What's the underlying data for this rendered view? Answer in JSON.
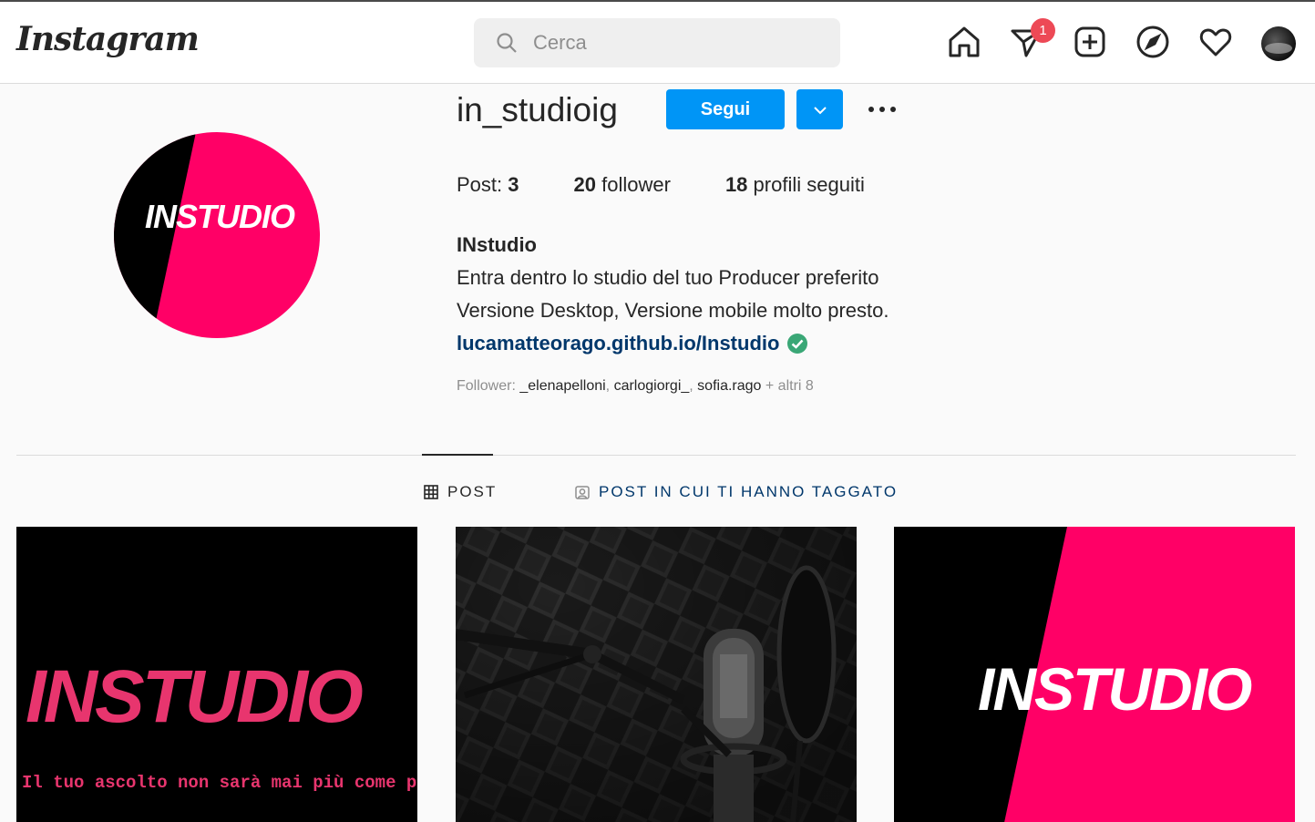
{
  "header": {
    "logo": "Instagram",
    "search_placeholder": "Cerca",
    "notification_count": "1",
    "icons": [
      "home-icon",
      "direct-message-icon",
      "new-post-icon",
      "explore-icon",
      "activity-heart-icon",
      "profile-avatar"
    ]
  },
  "profile": {
    "username": "in_studioig",
    "follow_label": "Segui",
    "picture_text": "INSTUDIO",
    "stats": {
      "posts_label": "Post:",
      "posts_count": "3",
      "followers_count": "20",
      "followers_label": "follower",
      "following_count": "18",
      "following_label": "profili seguiti"
    },
    "full_name": "INstudio",
    "bio_line1": "Entra dentro lo studio del tuo Producer preferito",
    "bio_line2": "Versione Desktop, Versione mobile molto presto.",
    "link": "lucamatteorago.github.io/Instudio",
    "followed_by": {
      "prefix": "Follower:",
      "user1": "_elenapelloni",
      "user2": "carlogiorgi_",
      "user3": "sofia.rago",
      "suffix": "+ altri 8"
    }
  },
  "tabs": {
    "posts": "POST",
    "tagged": "POST IN CUI TI HANNO TAGGATO"
  },
  "posts": [
    {
      "title": "INSTUDIO",
      "caption": "Il tuo ascolto non sarà mai più come pri"
    },
    {
      "title": ""
    },
    {
      "title": "INSTUDIO"
    }
  ],
  "colors": {
    "accent": "#0095f6",
    "brand_pink": "#ff0066",
    "link": "#00376b",
    "badge": "#ed4956"
  }
}
